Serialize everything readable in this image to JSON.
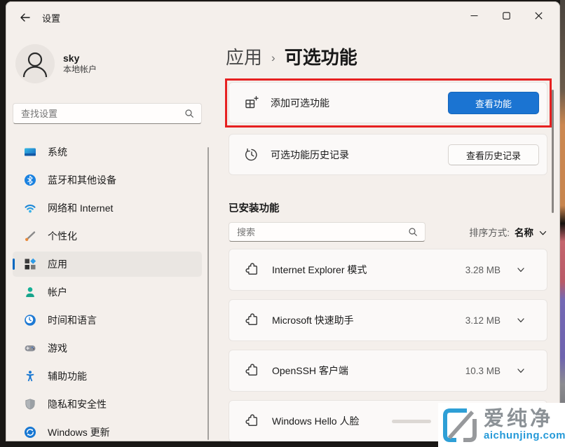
{
  "titlebar": {
    "app_title": "设置"
  },
  "user": {
    "name": "sky",
    "account_type": "本地帐户"
  },
  "sidebar": {
    "search_placeholder": "查找设置",
    "items": [
      {
        "label": "系统",
        "icon": "system-icon"
      },
      {
        "label": "蓝牙和其他设备",
        "icon": "bluetooth-icon"
      },
      {
        "label": "网络和 Internet",
        "icon": "network-icon"
      },
      {
        "label": "个性化",
        "icon": "personalization-icon"
      },
      {
        "label": "应用",
        "icon": "apps-icon",
        "selected": true
      },
      {
        "label": "帐户",
        "icon": "accounts-icon"
      },
      {
        "label": "时间和语言",
        "icon": "time-language-icon"
      },
      {
        "label": "游戏",
        "icon": "gaming-icon"
      },
      {
        "label": "辅助功能",
        "icon": "accessibility-icon"
      },
      {
        "label": "隐私和安全性",
        "icon": "privacy-icon"
      },
      {
        "label": "Windows 更新",
        "icon": "windows-update-icon"
      }
    ]
  },
  "main": {
    "breadcrumb": {
      "parent": "应用",
      "separator": "›",
      "current": "可选功能"
    },
    "add_card": {
      "label": "添加可选功能",
      "button": "查看功能",
      "icon": "add-feature-icon"
    },
    "history_card": {
      "label": "可选功能历史记录",
      "button": "查看历史记录",
      "icon": "history-icon"
    },
    "installed": {
      "heading": "已安装功能",
      "search_placeholder": "搜索",
      "sort_label": "排序方式:",
      "sort_value": "名称",
      "features": [
        {
          "name": "Internet Explorer 模式",
          "size": "3.28 MB",
          "icon": "puzzle-icon"
        },
        {
          "name": "Microsoft 快速助手",
          "size": "3.12 MB",
          "icon": "puzzle-icon"
        },
        {
          "name": "OpenSSH 客户端",
          "size": "10.3 MB",
          "icon": "puzzle-icon"
        },
        {
          "name": "Windows Hello 人脸",
          "size": "",
          "icon": "puzzle-icon"
        }
      ]
    }
  },
  "watermark": {
    "title": "爱纯净",
    "domain": "aichunjing.com"
  },
  "colors": {
    "accent_button": "#1b74d2",
    "highlight_red": "#e62020",
    "nav_accent_pill": "#0067c0",
    "watermark_blue": "#2499d8",
    "watermark_gray": "#8b9196",
    "window_background": "#f4efeb"
  }
}
